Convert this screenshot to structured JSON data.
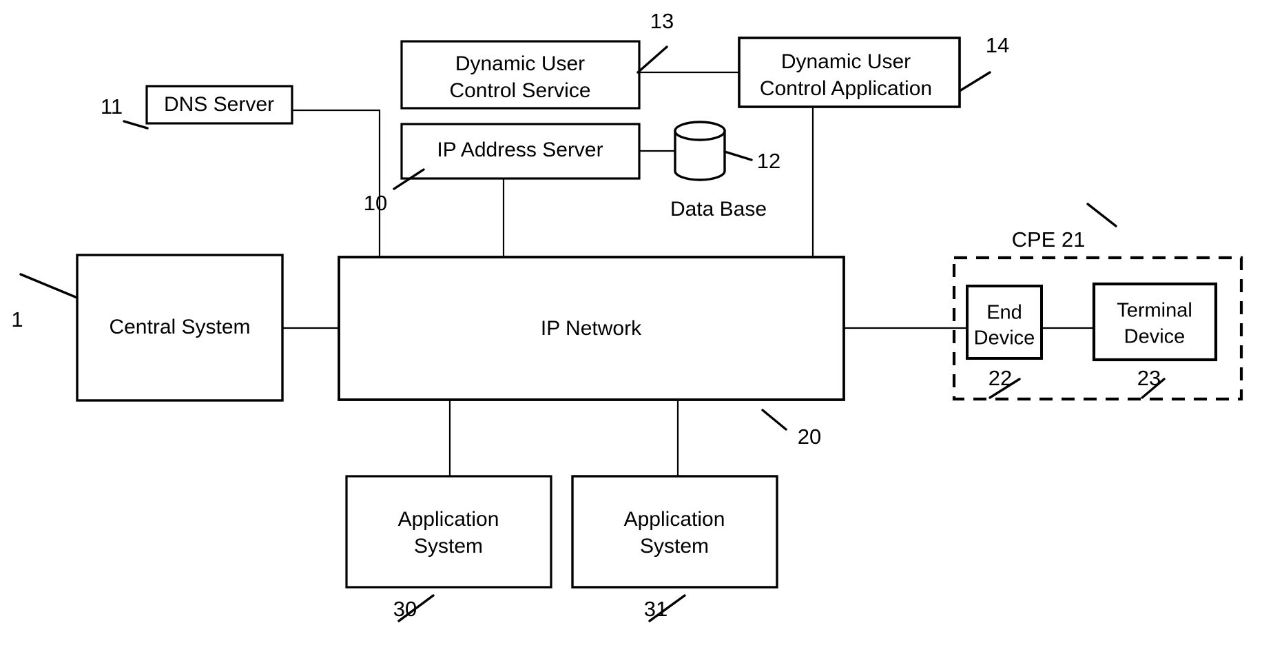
{
  "figure": {
    "type": "patent-block-diagram",
    "background_color": "#ffffff",
    "line_color": "#000000"
  },
  "nodes": {
    "dns_server": {
      "label": "DNS Server",
      "ref": "11"
    },
    "dynamic_user_control_service": {
      "label_line1": "Dynamic User",
      "label_line2": "Control Service",
      "ref": "13"
    },
    "dynamic_user_control_application": {
      "label_line1": "Dynamic User",
      "label_line2": "Control Application",
      "ref": "14"
    },
    "ip_address_server": {
      "label": "IP Address Server",
      "ref": "10"
    },
    "database": {
      "label": "Data Base",
      "ref": "12"
    },
    "central_system": {
      "label": "Central System",
      "ref": "1"
    },
    "ip_network": {
      "label": "IP Network",
      "ref": "20"
    },
    "application_system_30": {
      "label_line1": "Application",
      "label_line2": "System",
      "ref": "30"
    },
    "application_system_31": {
      "label_line1": "Application",
      "label_line2": "System",
      "ref": "31"
    },
    "end_device": {
      "label_line1": "End",
      "label_line2": "Device",
      "ref": "22"
    },
    "terminal_device": {
      "label_line1": "Terminal",
      "label_line2": "Device",
      "ref": "23"
    },
    "cpe_group": {
      "label": "CPE  21",
      "ref": "21"
    }
  }
}
